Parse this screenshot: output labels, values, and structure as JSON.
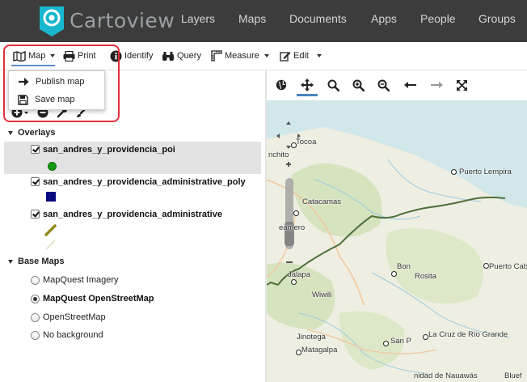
{
  "brand": {
    "name": "Cartoview"
  },
  "nav": {
    "items": [
      "Layers",
      "Maps",
      "Documents",
      "Apps",
      "People",
      "Groups"
    ]
  },
  "toolbar": {
    "map_label": "Map",
    "print_label": "Print",
    "identify_label": "Identify",
    "query_label": "Query",
    "measure_label": "Measure",
    "edit_label": "Edit"
  },
  "map_menu": {
    "items": [
      {
        "label": "Publish map",
        "icon": "arrow-right-icon"
      },
      {
        "label": "Save map",
        "icon": "floppy-disk-icon"
      }
    ]
  },
  "overlays": {
    "title": "Overlays",
    "layers": [
      {
        "name": "san_andres_y_providencia_poi",
        "checked": true,
        "legend": "green-point"
      },
      {
        "name": "san_andres_y_providencia_administrative_poly",
        "checked": true,
        "legend": "navy-square"
      },
      {
        "name": "san_andres_y_providencia_administrative",
        "checked": true,
        "legend": "olive-line"
      }
    ]
  },
  "base_maps": {
    "title": "Base Maps",
    "options": [
      {
        "label": "MapQuest Imagery",
        "selected": false
      },
      {
        "label": "MapQuest OpenStreetMap",
        "selected": true
      },
      {
        "label": "OpenStreetMap",
        "selected": false
      },
      {
        "label": "No background",
        "selected": false
      }
    ]
  },
  "map": {
    "places": [
      "Tocoa",
      "nchito",
      "Puerto Lempira",
      "Catacamas",
      "eamero",
      "Bon",
      "Rosita",
      "Puerto Cabe",
      "Jalapa",
      "Wiwili",
      "Jinotega",
      "Matagalpa",
      "San P",
      "La Cruz de Río Grande",
      "nidad de Nauawás",
      "Bluef"
    ]
  },
  "colors": {
    "nav_bg": "#3c3c3c",
    "accent": "#5b8fc7",
    "highlight": "#e0303a",
    "logo": "#18b7cf",
    "border_line": "#4f6f3a"
  }
}
